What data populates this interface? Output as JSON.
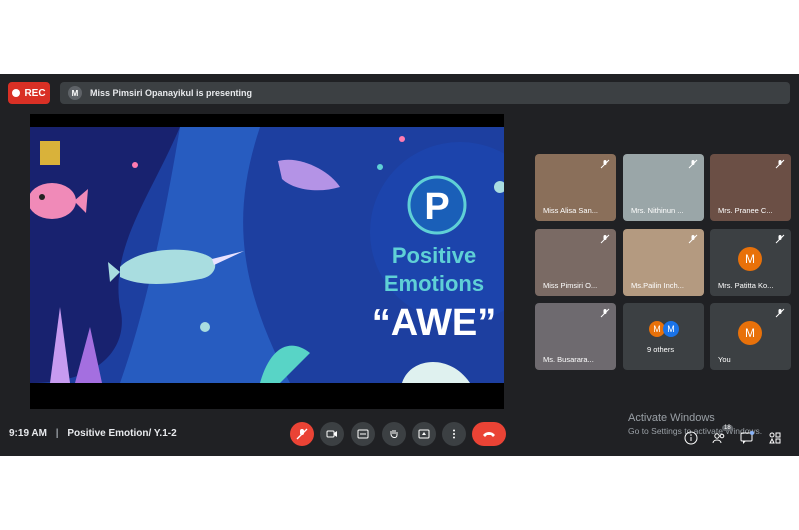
{
  "recording": {
    "label": "REC"
  },
  "banner": {
    "avatar": "M",
    "text": "Miss Pimsiri Opanayikul is presenting"
  },
  "slide": {
    "badge": "P",
    "title_line1": "Positive",
    "title_line2": "Emotions",
    "title_line3": "“AWE”"
  },
  "participants": [
    {
      "name": "Miss Alisa San...",
      "muted": true
    },
    {
      "name": "Mrs. Nithinun ...",
      "muted": true
    },
    {
      "name": "Mrs. Pranee C...",
      "muted": true
    },
    {
      "name": "Miss Pimsiri O...",
      "muted": true
    },
    {
      "name": "Ms.Pailin Inch...",
      "muted": true
    },
    {
      "name": "Mrs. Patitta Ko...",
      "muted": true,
      "avatar": "M"
    },
    {
      "name": "Ms. Busarara...",
      "muted": true
    },
    {
      "name": "9 others",
      "avatars": [
        "M",
        "M"
      ]
    },
    {
      "name": "You",
      "muted": true,
      "avatar": "M"
    }
  ],
  "meeting": {
    "time": "9:19 AM",
    "separator": "|",
    "title": "Positive Emotion/ Y.1-2"
  },
  "controls": [
    "mic-off-icon",
    "camera-icon",
    "captions-icon",
    "raise-hand-icon",
    "present-icon",
    "more-icon",
    "end-call-icon"
  ],
  "windows_notice": {
    "line1": "Activate Windows",
    "line2": "Go to Settings to activate Windows."
  },
  "right_badges": {
    "people_count": "18"
  },
  "colors": {
    "background": "#202124",
    "tile": "#3c4043",
    "red": "#ea4335",
    "avatar": "#e8710a",
    "slide_bg": "#1f4aa6",
    "slide_text": "#5fd0d6"
  }
}
